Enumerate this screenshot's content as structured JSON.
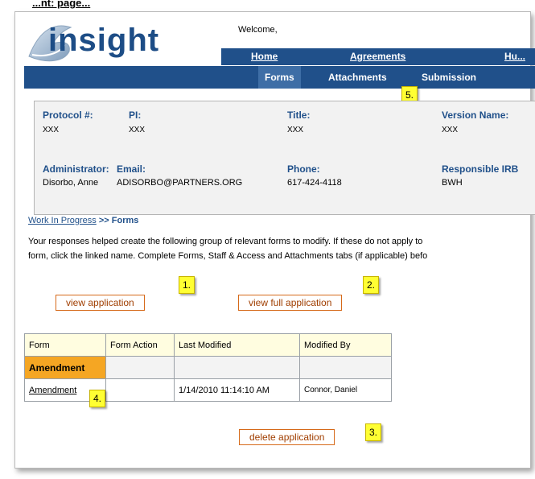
{
  "top_text": "...nt: page...",
  "header": {
    "logo_text": "insight",
    "welcome": "Welcome,"
  },
  "nav_primary": [
    "Home",
    "Agreements",
    "Hu..."
  ],
  "nav_secondary": {
    "tabs": [
      "Forms",
      "Attachments",
      "Submission"
    ],
    "active": "Forms"
  },
  "protocol": {
    "protocol_label": "Protocol #:",
    "protocol_value": "XXX",
    "pi_label": "PI:",
    "pi_value": "XXX",
    "title_label": "Title:",
    "title_value": "XXX",
    "version_label": "Version Name:",
    "version_value": "XXX",
    "admin_label": "Administrator:",
    "admin_value": "Disorbo, Anne",
    "email_label": "Email:",
    "email_value": "ADISORBO@PARTNERS.ORG",
    "phone_label": "Phone:",
    "phone_value": "617-424-4118",
    "irb_label": "Responsible IRB",
    "irb_value": "BWH"
  },
  "breadcrumb": {
    "link": "Work In Progress",
    "separator": " >> ",
    "current": "Forms"
  },
  "description": {
    "line1": "Your responses helped create the following group of relevant forms to modify. If these do not apply to",
    "line2": "form, click the linked name. Complete Forms, Staff & Access and Attachments tabs (if applicable) befo"
  },
  "buttons": {
    "view_application": "view application",
    "view_full_application": "view full application",
    "delete_application": "delete application"
  },
  "callouts": [
    "1.",
    "2.",
    "3.",
    "4.",
    "5."
  ],
  "table": {
    "headers": [
      "Form",
      "Form Action",
      "Last Modified",
      "Modified By"
    ],
    "group_label": "Amendment",
    "row": {
      "form": "Amendment",
      "form_action": "",
      "last_modified": "1/14/2010 11:14:10 AM",
      "modified_by": "Connor, Daniel"
    }
  }
}
